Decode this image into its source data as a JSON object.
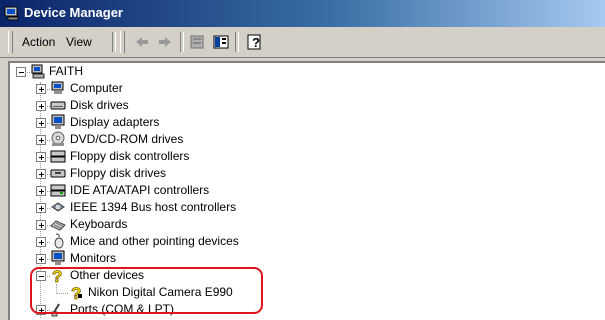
{
  "window": {
    "title": "Device Manager"
  },
  "menu": {
    "action": "Action",
    "view": "View"
  },
  "toolbar": {
    "icons": [
      "back-arrow-icon",
      "forward-arrow-icon",
      "properties-icon",
      "scan-icon",
      "help-icon"
    ]
  },
  "tree": {
    "root": "FAITH",
    "categories": [
      "Computer",
      "Disk drives",
      "Display adapters",
      "DVD/CD-ROM drives",
      "Floppy disk controllers",
      "Floppy disk drives",
      "IDE ATA/ATAPI controllers",
      "IEEE 1394 Bus host controllers",
      "Keyboards",
      "Mice and other pointing devices",
      "Monitors",
      "Other devices",
      "Ports (COM & LPT)"
    ],
    "other_child": "Nikon Digital Camera E990"
  },
  "colors": {
    "title_start": "#0a246a",
    "title_end": "#a6caf0",
    "highlight": "#e0141c",
    "question": "#f3e500"
  }
}
